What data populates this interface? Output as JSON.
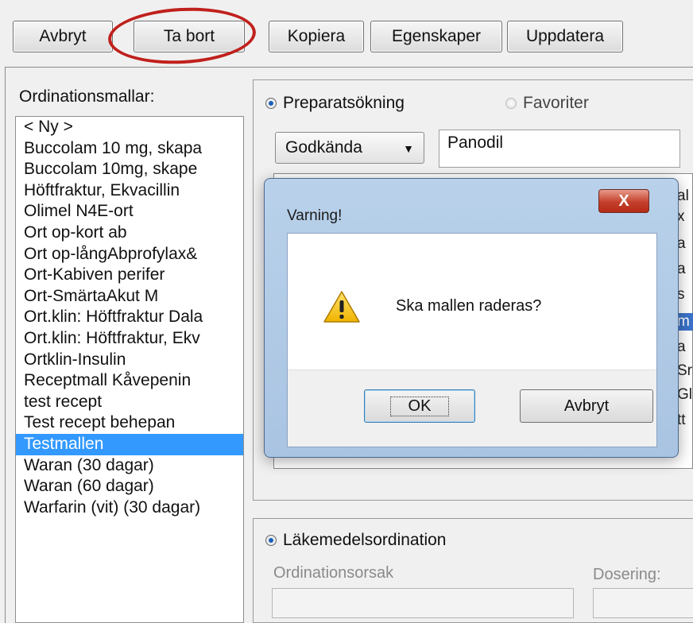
{
  "toolbar": {
    "buttons": [
      {
        "label": "Avbryt"
      },
      {
        "label": "Ta bort"
      },
      {
        "label": "Kopiera"
      },
      {
        "label": "Egenskaper"
      },
      {
        "label": "Uppdatera"
      }
    ]
  },
  "templates": {
    "label": "Ordinationsmallar:",
    "items": [
      "< Ny >",
      "Buccolam 10 mg, skapa",
      "Buccolam 10mg, skape",
      "Höftfraktur, Ekvacillin",
      "Olimel N4E-ort",
      "Ort op-kort ab",
      "Ort op-långAbprofylax&",
      "Ort-Kabiven perifer",
      "Ort-SmärtaAkut M",
      "Ort.klin: Höftfraktur Dala",
      "Ort.klin: Höftfraktur, Ekv",
      "Ortklin-Insulin",
      "Receptmall Kåvepenin",
      "test recept",
      "Test recept behepan",
      "Testmallen",
      "Waran (30 dagar)",
      "Waran (60 dagar)",
      "Warfarin (vit) (30 dagar)"
    ],
    "selected_index": 15
  },
  "search": {
    "mode_preparat": "Preparatsökning",
    "mode_favoriter": "Favoriter",
    "filter_value": "Godkända",
    "query": "Panodil",
    "result_fragments": [
      "al",
      "x",
      "a",
      "a",
      "s",
      "m",
      "a",
      "Sr",
      "Gl",
      "tt"
    ]
  },
  "order": {
    "mode_label": "Läkemedelsordination",
    "reason_label": "Ordinationsorsak",
    "dosage_label": "Dosering:"
  },
  "dialog": {
    "title": "Varning!",
    "close_glyph": "X",
    "message": "Ska mallen raderas?",
    "ok_label": "OK",
    "cancel_label": "Avbryt"
  },
  "colors": {
    "selection": "#3399ff",
    "annotation_circle": "#c0201c"
  },
  "icons": {
    "warning": "warning-triangle-icon",
    "close": "close-icon",
    "dropdown": "chevron-down-icon"
  }
}
